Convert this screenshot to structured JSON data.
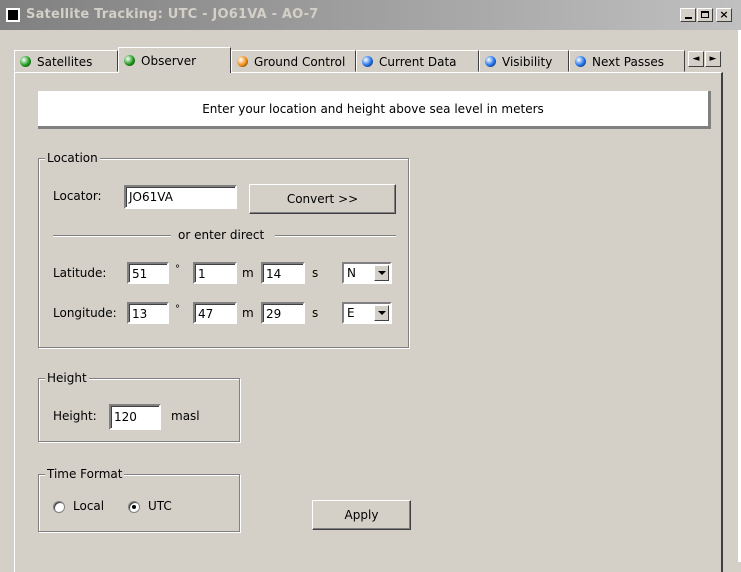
{
  "window": {
    "title": "Satellite Tracking: UTC - JO61VA - AO-7",
    "minimize_label": "_",
    "maximize_label": "□",
    "close_label": "×"
  },
  "tabs": [
    {
      "label": "Satellites",
      "dot_color": "#1a9a1a",
      "active": false
    },
    {
      "label": "Observer",
      "dot_color": "#1a9a1a",
      "active": true
    },
    {
      "label": "Ground Control",
      "dot_color": "#f08a10",
      "active": false
    },
    {
      "label": "Current Data",
      "dot_color": "#1e6ee8",
      "active": false
    },
    {
      "label": "Visibility",
      "dot_color": "#1e6ee8",
      "active": false
    },
    {
      "label": "Next Passes",
      "dot_color": "#1e6ee8",
      "active": false
    }
  ],
  "tab_scroll": {
    "left_icon": "◄",
    "right_icon": "►"
  },
  "banner": {
    "text": "Enter your location and height above sea level in meters"
  },
  "location": {
    "legend": "Location",
    "locator_label": "Locator:",
    "locator_value": "JO61VA",
    "convert_label": "Convert >>",
    "separator_text": "or enter direct",
    "latitude": {
      "label": "Latitude:",
      "deg": "51",
      "deg_unit": "°",
      "min": "1",
      "min_unit": "m",
      "sec": "14",
      "sec_unit": "s",
      "hemisphere": "N"
    },
    "longitude": {
      "label": "Longitude:",
      "deg": "13",
      "deg_unit": "°",
      "min": "47",
      "min_unit": "m",
      "sec": "29",
      "sec_unit": "s",
      "hemisphere": "E"
    }
  },
  "height": {
    "legend": "Height",
    "label": "Height:",
    "value": "120",
    "unit": "masl"
  },
  "time_format": {
    "legend": "Time Format",
    "options": [
      {
        "label": "Local",
        "selected": false
      },
      {
        "label": "UTC",
        "selected": true
      }
    ]
  },
  "apply_label": "Apply"
}
